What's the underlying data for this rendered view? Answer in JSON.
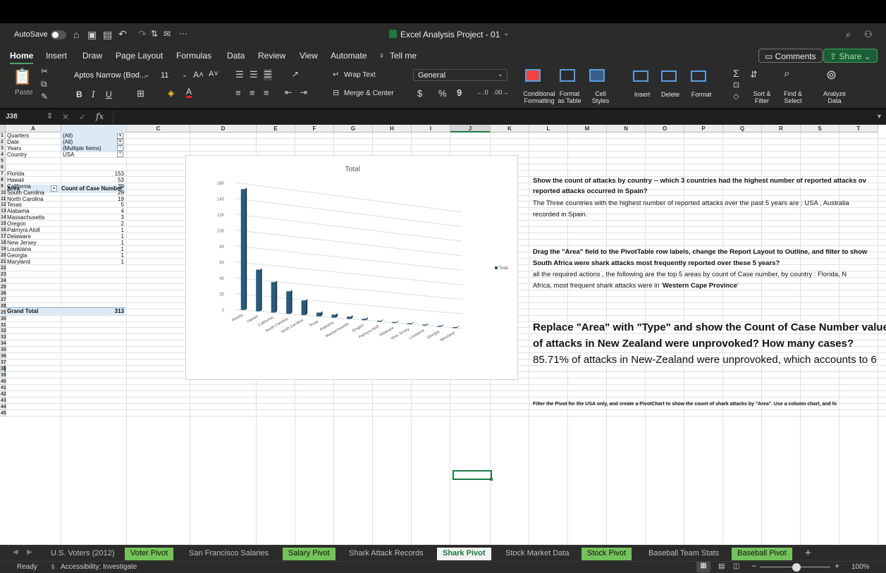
{
  "window": {
    "title": "Excel Analysis Project - 01",
    "autosave": "AutoSave"
  },
  "tabs": [
    "Home",
    "Insert",
    "Draw",
    "Page Layout",
    "Formulas",
    "Data",
    "Review",
    "View",
    "Automate",
    "Tell me"
  ],
  "actions": {
    "comments": "Comments",
    "share": "Share"
  },
  "ribbon": {
    "paste": "Paste",
    "font_name": "Aptos Narrow (Bod...",
    "font_size": "11",
    "wrap_text": "Wrap Text",
    "merge_center": "Merge & Center",
    "number_format": "General",
    "conditional": "Conditional",
    "formatting": "Formatting",
    "format_as": "Format",
    "as_table": "as Table",
    "cell": "Cell",
    "styles": "Styles",
    "insert": "Insert",
    "delete": "Delete",
    "format": "Format",
    "sort_filter": "Sort &",
    "filter": "Filter",
    "find_select": "Find &",
    "select": "Select",
    "analyze": "Analyze",
    "data": "Data",
    "dollar": "$",
    "percent": "%",
    "comma": "9"
  },
  "formula_bar": {
    "name_box": "J38",
    "fx": "fx",
    "value": ""
  },
  "columns": [
    "A",
    "B",
    "C",
    "D",
    "E",
    "F",
    "G",
    "H",
    "I",
    "J",
    "K",
    "L",
    "M",
    "N",
    "O",
    "P",
    "Q",
    "R",
    "S",
    "T"
  ],
  "rows": [
    "1",
    "2",
    "3",
    "4",
    "5",
    "6",
    "7",
    "8",
    "9",
    "10",
    "11",
    "12",
    "13",
    "14",
    "15",
    "16",
    "17",
    "18",
    "19",
    "20",
    "21",
    "22",
    "23",
    "24",
    "25",
    "26",
    "27",
    "28",
    "29",
    "30",
    "31",
    "32",
    "33",
    "34",
    "35",
    "36",
    "37",
    "38",
    "39",
    "40",
    "41",
    "42",
    "43",
    "44",
    "45"
  ],
  "filters": [
    {
      "label": "Quarters",
      "value": "(All)"
    },
    {
      "label": "Date",
      "value": "(All)"
    },
    {
      "label": "Years",
      "value": "(Multiple Items)"
    },
    {
      "label": "Country",
      "value": "USA"
    }
  ],
  "pivot": {
    "header_area": "Area",
    "header_count": "Count of Case Number",
    "rows": [
      {
        "area": "Florida",
        "count": "153"
      },
      {
        "area": "Hawaii",
        "count": "53"
      },
      {
        "area": "California",
        "count": "39"
      },
      {
        "area": "South Carolina",
        "count": "29"
      },
      {
        "area": "North Carolina",
        "count": "19"
      },
      {
        "area": "Texas",
        "count": "5"
      },
      {
        "area": "Alabama",
        "count": "4"
      },
      {
        "area": "Massachusetts",
        "count": "3"
      },
      {
        "area": "Oregon",
        "count": "2"
      },
      {
        "area": "Palmyra Atoll",
        "count": "1"
      },
      {
        "area": "Delaware",
        "count": "1"
      },
      {
        "area": "New Jersey",
        "count": "1"
      },
      {
        "area": "Louisiana",
        "count": "1"
      },
      {
        "area": "Georgia",
        "count": "1"
      },
      {
        "area": "Maryland",
        "count": "1"
      }
    ],
    "total_label": "Grand Total",
    "total_value": "313"
  },
  "chart_data": {
    "type": "bar",
    "title": "Total",
    "categories": [
      "Florida",
      "Hawaii",
      "California",
      "South Carolina",
      "North Carolina",
      "Texas",
      "Alabama",
      "Massachusetts",
      "Oregon",
      "Palmyra Atoll",
      "Delaware",
      "New Jersey",
      "Louisiana",
      "Georgia",
      "Maryland"
    ],
    "series": [
      {
        "name": "Total",
        "values": [
          153,
          53,
          39,
          29,
          19,
          5,
          4,
          3,
          2,
          1,
          1,
          1,
          1,
          1,
          1
        ]
      }
    ],
    "ylim": [
      0,
      160
    ],
    "yticks": [
      "0",
      "20",
      "40",
      "60",
      "80",
      "100",
      "120",
      "140",
      "160"
    ],
    "legend": "right",
    "grid": true
  },
  "questions": {
    "q1_line1": "Show the count of attacks by country -- which 3 countries had the highest number of reported attacks ov",
    "q1_line2": "reported attacks occurred in Spain?",
    "a1_line1": "The Three countries with the highest number of reported attacks over the past 5 years are  ; USA , Australia",
    "a1_line2": "recorded in Spain.",
    "q2_line1": "Drag the \"Area\" field to the PivotTable row labels, change the Report Layout to Outline, and filter to show",
    "q2_line2": "South Africa were shark attacks most frequently reported over these 5 years?",
    "a2_line1": "all the required actions , the following are the top 5 areas by count of Case number, by country  : Florida, N",
    "a2_line2_pre": "Africa, most frequent shark attacks were in '",
    "a2_line2_bold": "Western Cape Province",
    "a2_line2_post": "'",
    "q3_line1": "Replace \"Area\" with \"Type\" and show the Count of Case Number values",
    "q3_line2": "of attacks in New Zealand were unprovoked? How many cases?",
    "a3_line1": "85.71% of attacks in New-Zealand were unprovoked, which accounts to 6",
    "q4_line1": "Filter the Pivot for the USA only, and create a PivotChart to show the count of shark attacks by \"Area\". Use a column chart, and hi"
  },
  "sheets": [
    "U.S. Voters (2012)",
    "Voter Pivot",
    "San Francisco Salaries",
    "Salary Pivot",
    "Shark Attack Records",
    "Shark Pivot",
    "Stock Market Data",
    "Stock Pivot",
    "Baseball Team Stats",
    "Baseball Pivot"
  ],
  "status": {
    "ready": "Ready",
    "accessibility": "Accessibility: Investigate",
    "zoom": "100%"
  }
}
